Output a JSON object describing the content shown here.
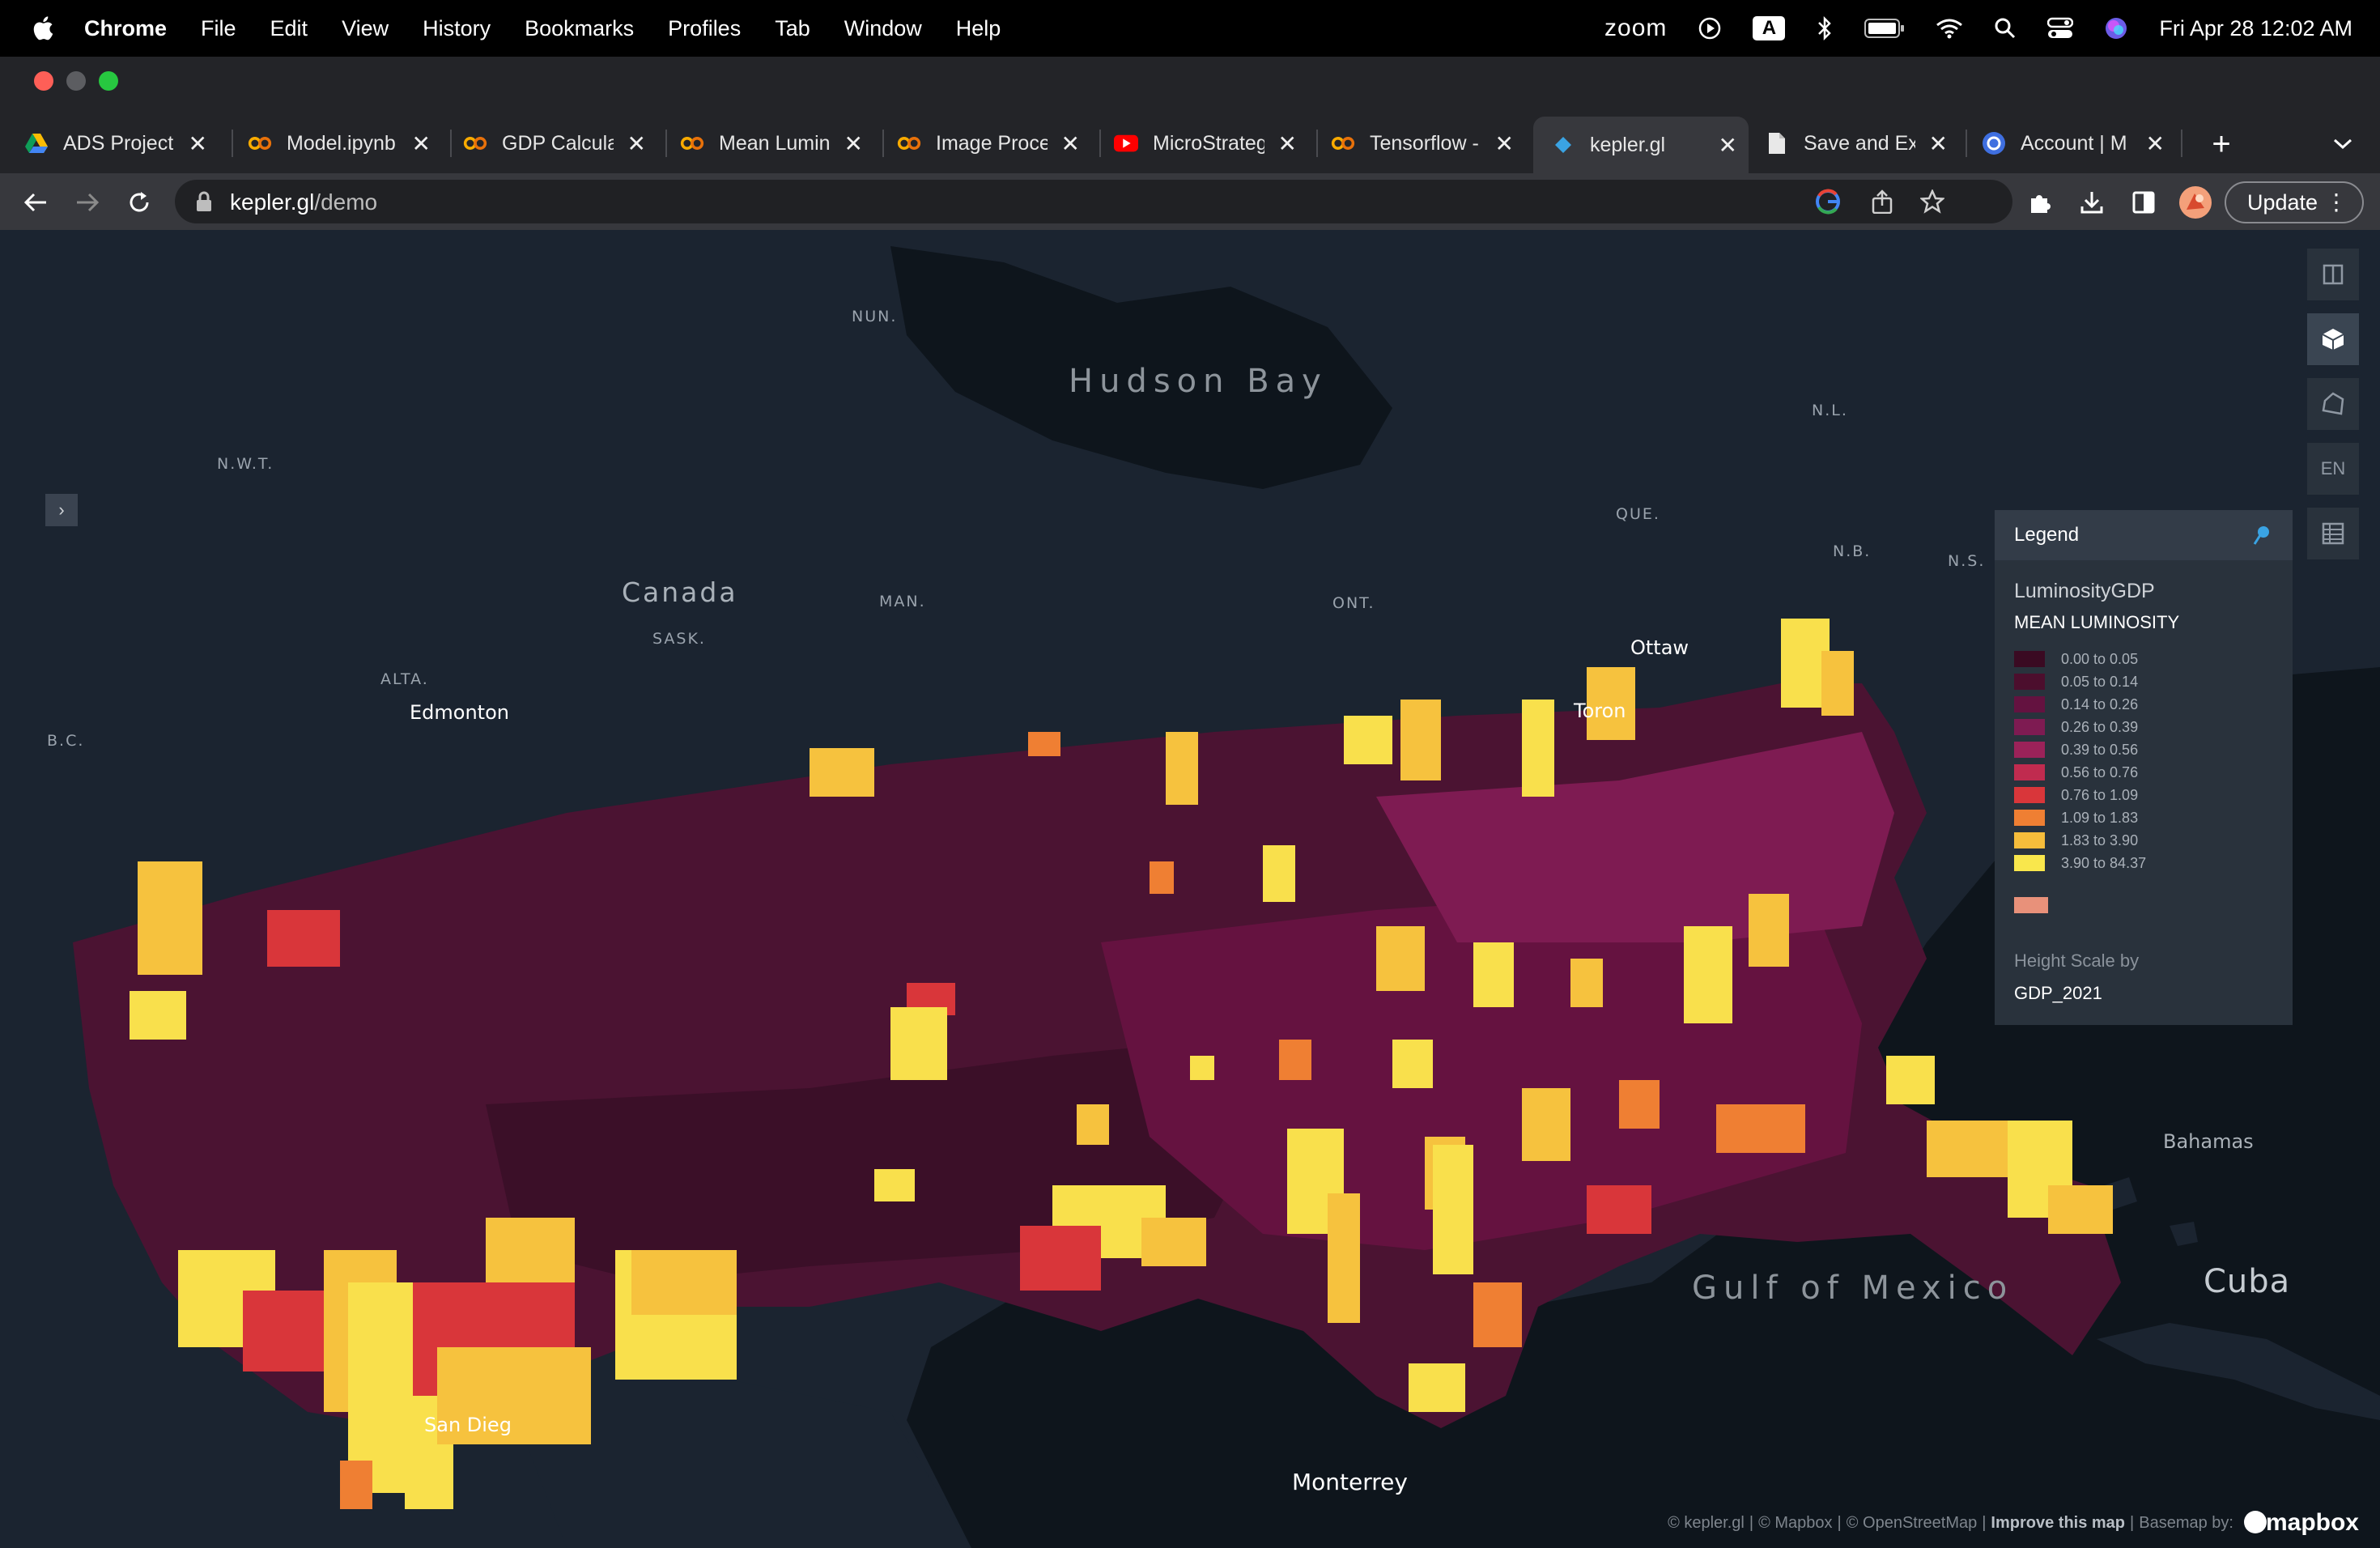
{
  "menubar": {
    "app_name": "Chrome",
    "items": [
      "File",
      "Edit",
      "View",
      "History",
      "Bookmarks",
      "Profiles",
      "Tab",
      "Window",
      "Help"
    ],
    "zoom": "zoom",
    "kbd": "A",
    "datetime": "Fri Apr 28  12:02 AM"
  },
  "tabs": [
    {
      "title": "ADS Project",
      "icon": "google-drive-icon"
    },
    {
      "title": "Model.ipynb",
      "icon": "colab-icon"
    },
    {
      "title": "GDP Calcula",
      "icon": "colab-icon"
    },
    {
      "title": "Mean Lumin",
      "icon": "colab-icon"
    },
    {
      "title": "Image Proce",
      "icon": "colab-icon"
    },
    {
      "title": "MicroStrateg",
      "icon": "youtube-icon"
    },
    {
      "title": "Tensorflow -",
      "icon": "colab-icon"
    },
    {
      "title": "kepler.gl",
      "icon": "kepler-icon",
      "active": true
    },
    {
      "title": "Save and Ex",
      "icon": "document-icon"
    },
    {
      "title": "Account | M",
      "icon": "account-icon"
    }
  ],
  "address": {
    "domain": "kepler.gl",
    "path": "/demo"
  },
  "toolbar": {
    "update_label": "Update"
  },
  "map": {
    "regions": [
      "NUN.",
      "N.W.T.",
      "ALTA.",
      "B.C.",
      "SASK.",
      "MAN.",
      "ONT.",
      "QUE.",
      "N.L.",
      "N.B.",
      "N.S."
    ],
    "big_labels": {
      "country": "Canada",
      "bay": "Hudson Bay",
      "gulf": "Gulf of Mexico",
      "cuba": "Cuba",
      "bahamas": "Bahamas"
    },
    "cities": {
      "edmonton": "Edmonton",
      "ottawa": "Ottaw",
      "toronto": "Toron",
      "monterrey": "Monterrey",
      "sandiego": "San Dieg"
    },
    "controls": {
      "locale": "EN"
    }
  },
  "legend": {
    "title": "Legend",
    "layer": "LuminosityGDP",
    "field": "MEAN LUMINOSITY",
    "bins": [
      {
        "label": "0.00 to 0.05",
        "color": "#3a0a22"
      },
      {
        "label": "0.05 to 0.14",
        "color": "#4c0e2d"
      },
      {
        "label": "0.14 to 0.26",
        "color": "#641240"
      },
      {
        "label": "0.26 to 0.39",
        "color": "#7e1b52"
      },
      {
        "label": "0.39 to 0.56",
        "color": "#9b2259"
      },
      {
        "label": "0.56 to 0.76",
        "color": "#c02b4f"
      },
      {
        "label": "0.76 to 1.09",
        "color": "#d9363a"
      },
      {
        "label": "1.09 to 1.83",
        "color": "#ef7f33"
      },
      {
        "label": "1.83 to 3.90",
        "color": "#f6bd3b"
      },
      {
        "label": "3.90 to 84.37",
        "color": "#f9e74c"
      }
    ],
    "height_label": "Height Scale by",
    "height_field": "GDP_2021"
  },
  "attribution": {
    "kepler": "© kepler.gl",
    "mapbox": "© Mapbox",
    "osm": "© OpenStreetMap",
    "improve": "Improve this map",
    "basemap": "Basemap by:",
    "brand": "mapbox"
  }
}
